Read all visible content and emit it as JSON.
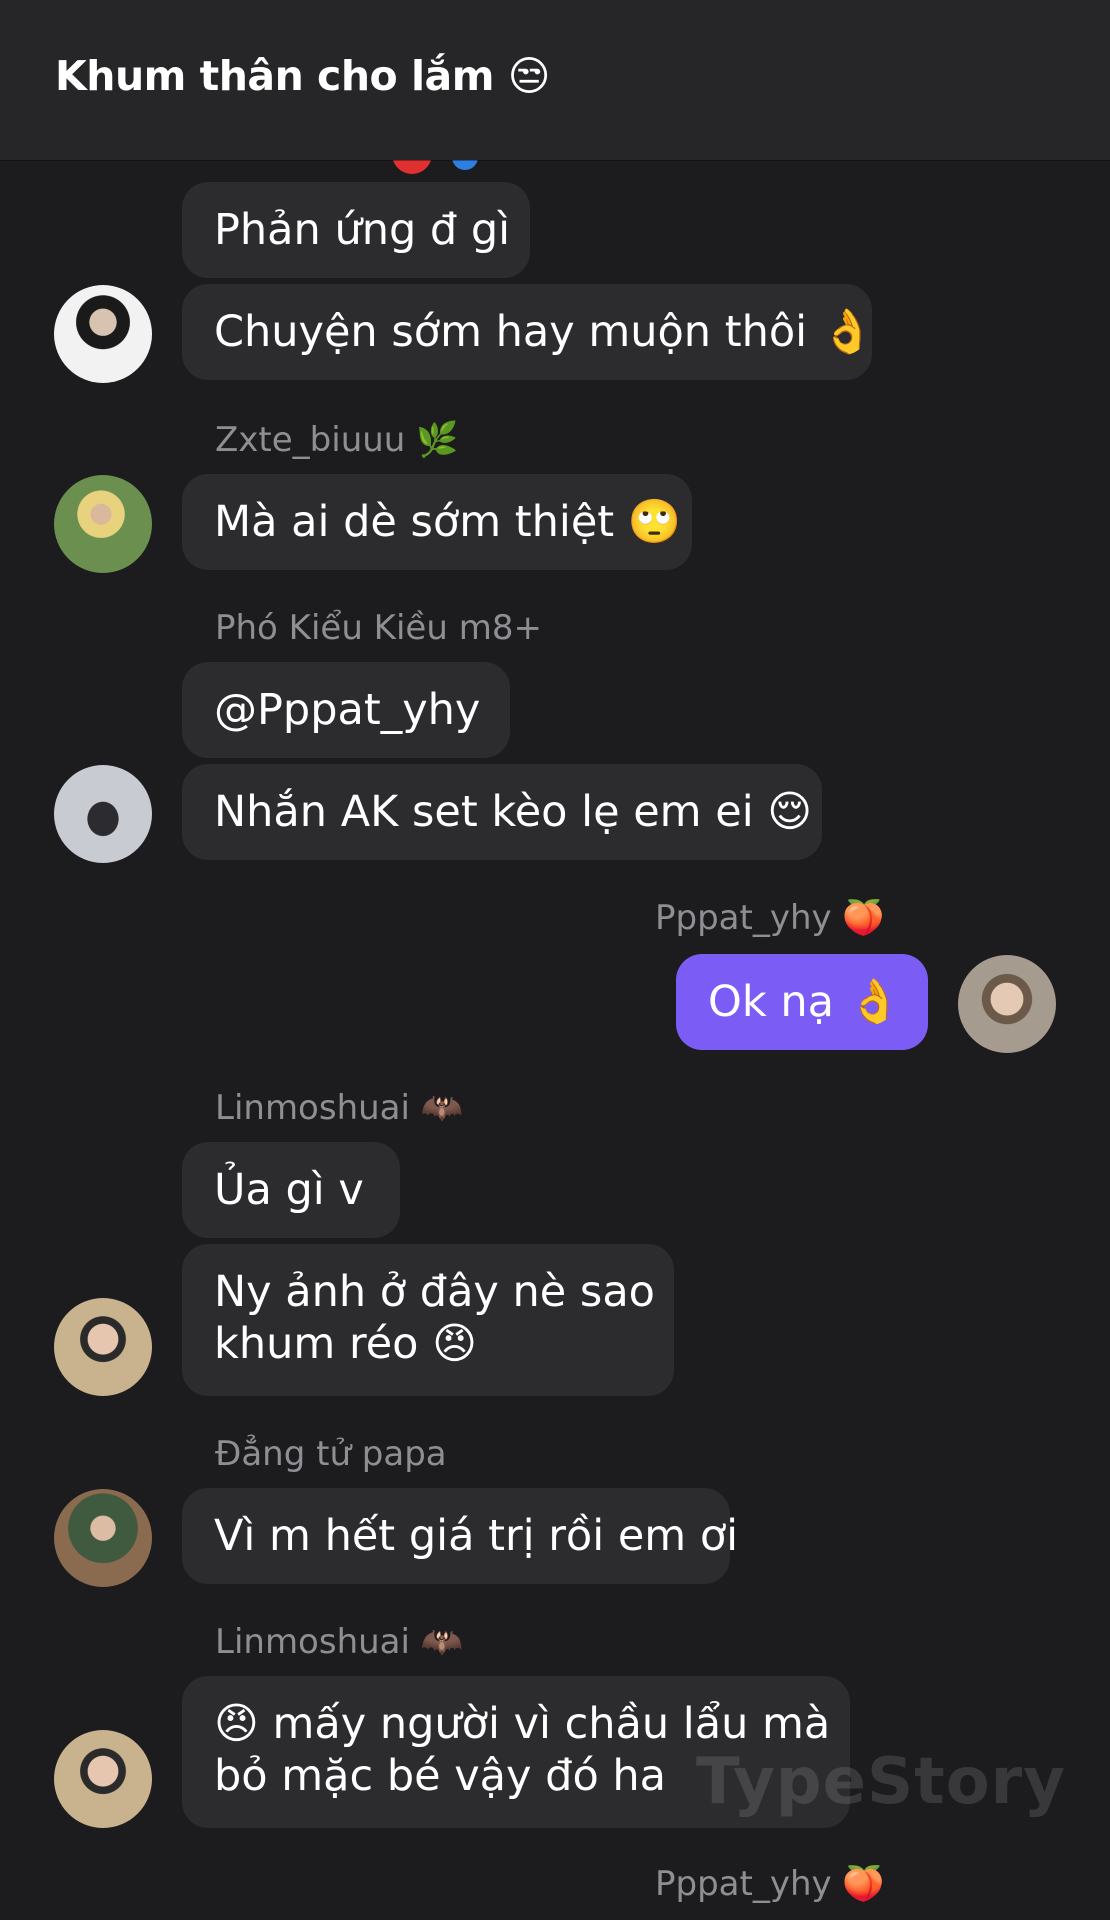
{
  "header": {
    "title": "Khum thân cho lắm 😒"
  },
  "messages": [
    {
      "sender": "",
      "texts": [
        "Phản ứng đ gì",
        "Chuyện sớm hay muộn thôi 👌"
      ]
    },
    {
      "sender": "Zxte_biuuu 🌿",
      "texts": [
        "Mà ai dè sớm thiệt 🙄"
      ]
    },
    {
      "sender": "Phó Kiểu Kiều m8+",
      "texts": [
        "@Pppat_yhy",
        "Nhắn AK set kèo lẹ em ei 😌"
      ]
    },
    {
      "sender": "Pppat_yhy 🍑",
      "texts": [
        "Ok nạ 👌"
      ],
      "mine": true
    },
    {
      "sender": "Linmoshuai 🦇",
      "texts": [
        "Ủa gì v",
        "Ny ảnh ở đây nè sao",
        "khum réo 😠"
      ]
    },
    {
      "sender": "Đẳng tử papa",
      "texts": [
        "Vì m hết giá trị rồi em ơi"
      ]
    },
    {
      "sender": "Linmoshuai 🦇",
      "texts": [
        "😠 mấy người vì chầu lẩu mà",
        "bỏ mặc bé vậy đó ha"
      ]
    },
    {
      "sender": "Pppat_yhy 🍑",
      "texts": [],
      "mine": true
    }
  ],
  "watermark": "TypeStory",
  "colors": {
    "background": "#1c1c1e",
    "header": "#262628",
    "bubble": "#2c2c2e",
    "my_bubble": "#7b5cf5",
    "name_text": "#8e8e93"
  }
}
